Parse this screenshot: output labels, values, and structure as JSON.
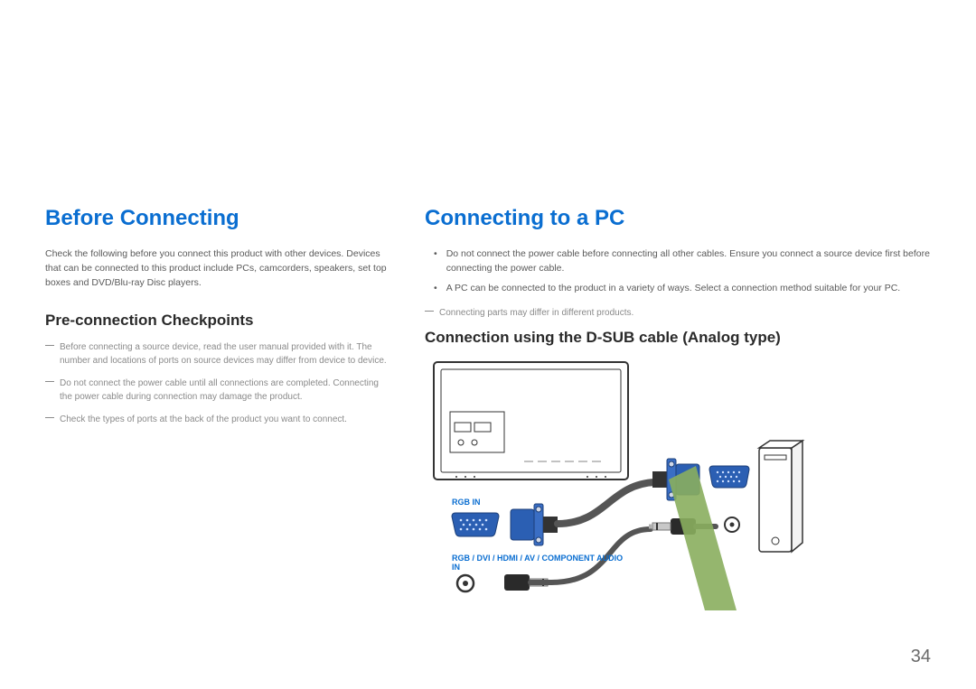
{
  "left": {
    "heading": "Before Connecting",
    "intro": "Check the following before you connect this product with other devices. Devices that can be connected to this product include PCs, camcorders, speakers, set top boxes and DVD/Blu-ray Disc players.",
    "subheading": "Pre-connection Checkpoints",
    "notes": [
      "Before connecting a source device, read the user manual provided with it. The number and locations of ports on source devices may differ from device to device.",
      "Do not connect the power cable until all connections are completed. Connecting the power cable during connection may damage the product.",
      "Check the types of ports at the back of the product you want to connect."
    ]
  },
  "right": {
    "heading": "Connecting to a PC",
    "bullets": [
      "Do not connect the power cable before connecting all other cables. Ensure you connect a source device first before connecting the power cable.",
      "A PC can be connected to the product in a variety of ways. Select a connection method suitable for your PC."
    ],
    "note": "Connecting parts may differ in different products.",
    "subheading": "Connection using the D-SUB cable (Analog type)",
    "labels": {
      "rgbIn": "RGB IN",
      "audioIn": "RGB / DVI / HDMI / AV / COMPONENT AUDIO IN"
    }
  },
  "pageNumber": "34"
}
